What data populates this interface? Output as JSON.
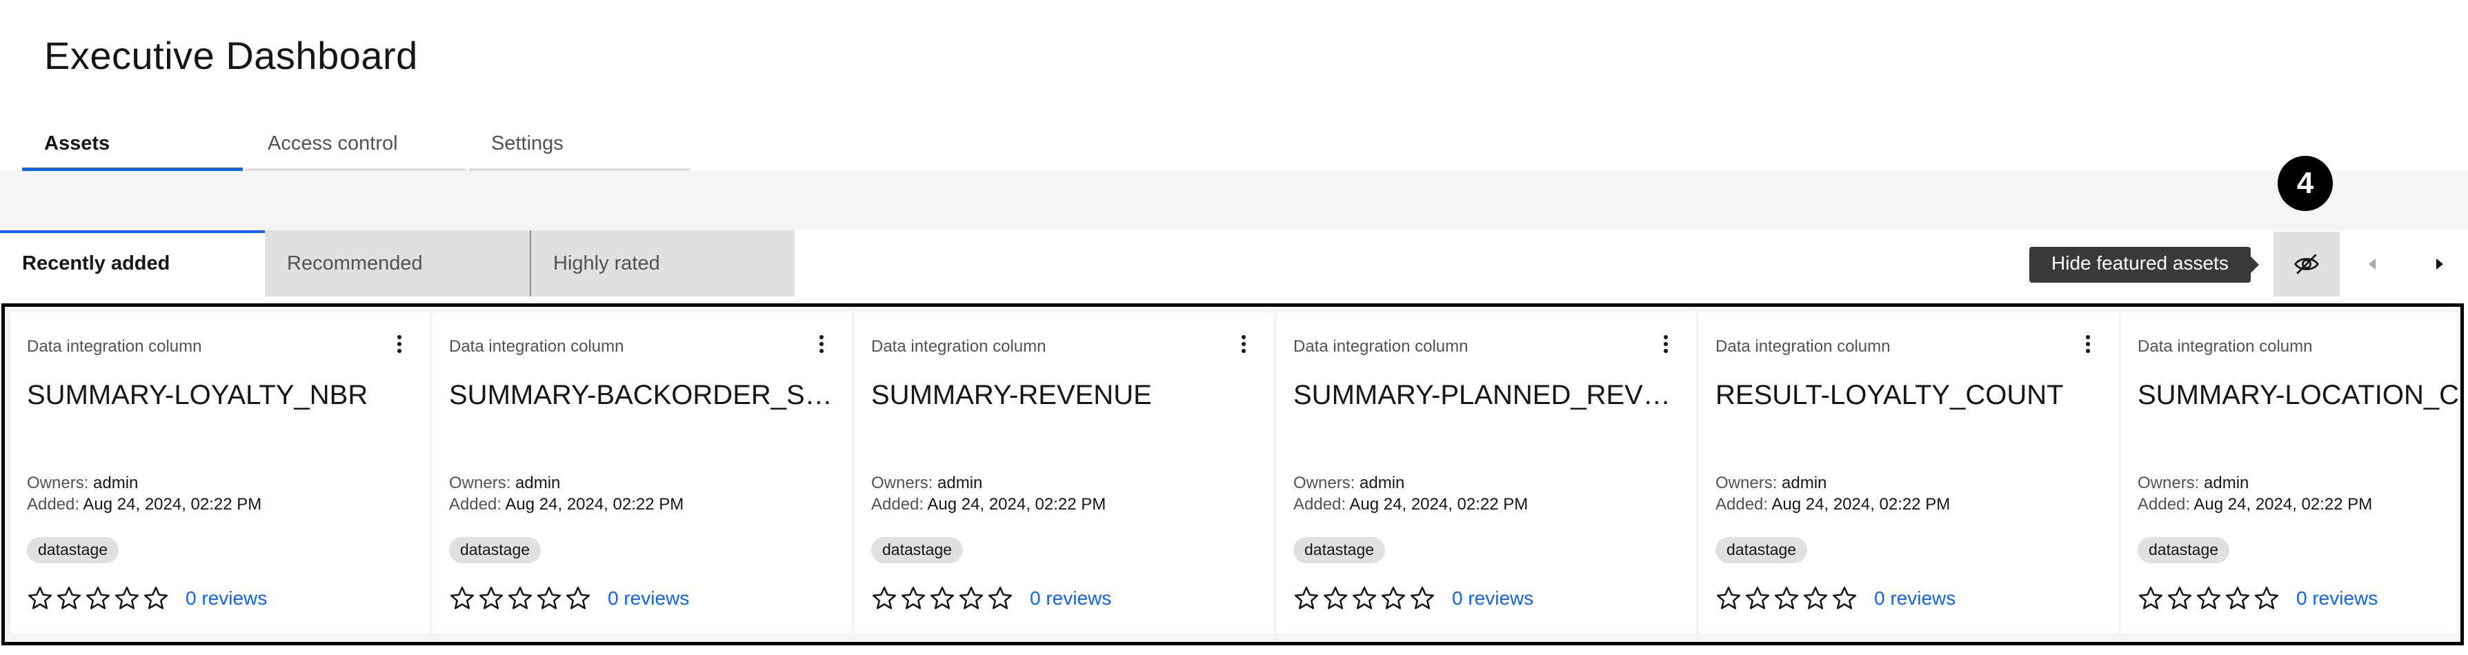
{
  "page": {
    "title": "Executive Dashboard"
  },
  "tabs": [
    {
      "label": "Assets",
      "active": true
    },
    {
      "label": "Access control",
      "active": false
    },
    {
      "label": "Settings",
      "active": false
    }
  ],
  "subtabs": [
    {
      "label": "Recently added",
      "active": true
    },
    {
      "label": "Recommended",
      "active": false
    },
    {
      "label": "Highly rated",
      "active": false
    }
  ],
  "toolbar": {
    "tooltip": "Hide featured assets",
    "hide_icon": "eye-slash-icon",
    "prev_icon": "caret-left-icon",
    "next_icon": "caret-right-icon"
  },
  "annotation": {
    "badge": "4"
  },
  "labels": {
    "owners": "Owners:",
    "added": "Added:"
  },
  "cards": [
    {
      "type": "Data integration column",
      "title": "SUMMARY-LOYALTY_NBR",
      "owner": "admin",
      "added": "Aug 24, 2024, 02:22 PM",
      "tag": "datastage",
      "rating": 0,
      "reviews": "0 reviews"
    },
    {
      "type": "Data integration column",
      "title": "SUMMARY-BACKORDER_ST...",
      "owner": "admin",
      "added": "Aug 24, 2024, 02:22 PM",
      "tag": "datastage",
      "rating": 0,
      "reviews": "0 reviews"
    },
    {
      "type": "Data integration column",
      "title": "SUMMARY-REVENUE",
      "owner": "admin",
      "added": "Aug 24, 2024, 02:22 PM",
      "tag": "datastage",
      "rating": 0,
      "reviews": "0 reviews"
    },
    {
      "type": "Data integration column",
      "title": "SUMMARY-PLANNED_REVE...",
      "owner": "admin",
      "added": "Aug 24, 2024, 02:22 PM",
      "tag": "datastage",
      "rating": 0,
      "reviews": "0 reviews"
    },
    {
      "type": "Data integration column",
      "title": "RESULT-LOYALTY_COUNT",
      "owner": "admin",
      "added": "Aug 24, 2024, 02:22 PM",
      "tag": "datastage",
      "rating": 0,
      "reviews": "0 reviews"
    },
    {
      "type": "Data integration column",
      "title": "SUMMARY-LOCATION_COD",
      "owner": "admin",
      "added": "Aug 24, 2024, 02:22 PM",
      "tag": "datastage",
      "rating": 0,
      "reviews": "0 reviews"
    }
  ],
  "colors": {
    "accent": "#0f62fe",
    "tooltip_bg": "#393939",
    "tag_bg": "#e0e0e0"
  }
}
